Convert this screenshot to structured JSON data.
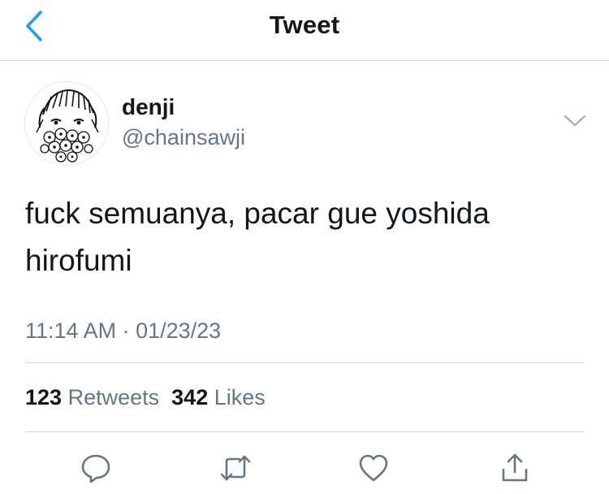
{
  "header": {
    "title": "Tweet",
    "back_icon": "chevron-left-icon",
    "accent_color": "#1da1f2"
  },
  "author": {
    "display_name": "denji",
    "handle": "@chainsawji"
  },
  "tweet": {
    "text": "fuck semuanya, pacar gue yoshida hirofumi",
    "timestamp": "11:14 AM · 01/23/23"
  },
  "stats": {
    "retweets_count": "123",
    "retweets_label": "Retweets",
    "likes_count": "342",
    "likes_label": "Likes"
  },
  "actions": [
    {
      "name": "reply",
      "icon": "reply-icon"
    },
    {
      "name": "retweet",
      "icon": "retweet-icon"
    },
    {
      "name": "like",
      "icon": "heart-icon"
    },
    {
      "name": "share",
      "icon": "share-icon"
    }
  ],
  "colors": {
    "text_primary": "#14171a",
    "text_secondary": "#657786",
    "divider": "#d6d9dc",
    "icon_gray": "#657786"
  }
}
